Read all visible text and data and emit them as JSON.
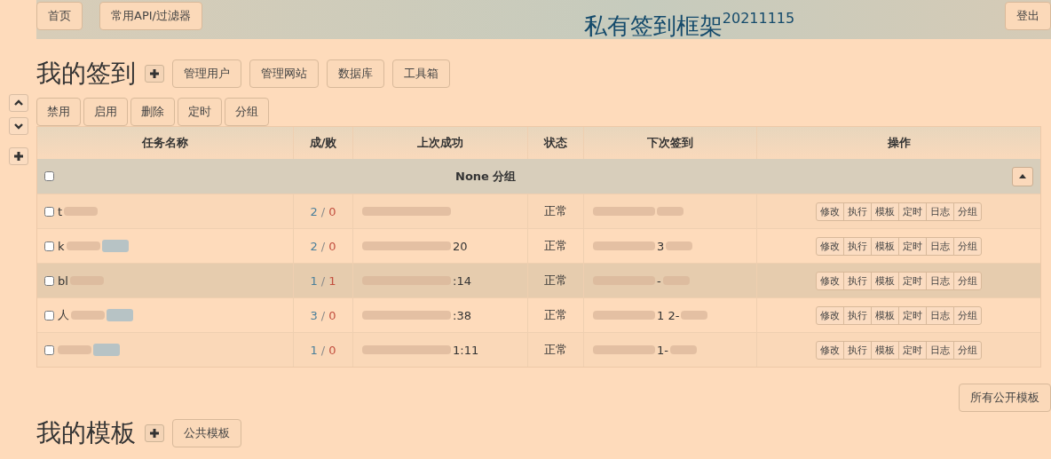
{
  "nav": {
    "buttons": [
      "首页",
      "常用API/过滤器"
    ],
    "title": "私有签到框架$^{20211115}$",
    "logout": "登出"
  },
  "side_buttons": [
    {
      "kind": "up"
    },
    {
      "kind": "down"
    },
    {
      "kind": "plus"
    }
  ],
  "tasks_section": {
    "heading": "我的签到",
    "buttons": [
      "管理用户",
      "管理网站",
      "数据库",
      "工具箱"
    ],
    "batch_buttons": [
      "禁用",
      "启用",
      "删除",
      "定时",
      "分组"
    ]
  },
  "table": {
    "columns": [
      "任务名称",
      "成/败",
      "上次成功",
      "状态",
      "下次签到",
      "操作"
    ],
    "group": {
      "label": "None 分组",
      "checked": false,
      "expanded": true
    },
    "rows": [
      {
        "checked": false,
        "name": "t",
        "tag": false,
        "success": "2",
        "sep": "/",
        "fail": "0",
        "last": "",
        "status": "正常",
        "next": "",
        "highlighted": false
      },
      {
        "checked": false,
        "name": "k",
        "tag": true,
        "success": "2",
        "sep": "/",
        "fail": "0",
        "last": "20",
        "status": "正常",
        "next": "3",
        "highlighted": false
      },
      {
        "checked": false,
        "name": "bl",
        "tag": false,
        "success": "1",
        "sep": "/",
        "fail": "1",
        "last": ":14",
        "status": "正常",
        "next": "-",
        "highlighted": true
      },
      {
        "checked": false,
        "name": "人",
        "tag": true,
        "success": "3",
        "sep": "/",
        "fail": "0",
        "last": ":38",
        "status": "正常",
        "next": "1 2-",
        "highlighted": false
      },
      {
        "checked": false,
        "name": "",
        "tag": true,
        "success": "1",
        "sep": "/",
        "fail": "0",
        "last": "1:11",
        "status": "正常",
        "next": "1-",
        "highlighted": false
      }
    ],
    "actions": [
      [
        "修改",
        "执行",
        "模板",
        "定时",
        "日志",
        "分组"
      ],
      [
        "修改",
        "执行",
        "模板",
        "定时",
        "日志",
        "分组"
      ],
      [
        "修改",
        "执行",
        "模板",
        "定时",
        "日志",
        "分组"
      ],
      [
        "修改",
        "执行",
        "模板",
        "定时",
        "日志",
        "分组"
      ],
      [
        "修改",
        "执行",
        "模板",
        "定时",
        "日志",
        "分组"
      ]
    ]
  },
  "public_templates_button": "所有公开模板",
  "templates_section": {
    "heading": "我的模板",
    "buttons": [
      "公共模板"
    ]
  }
}
